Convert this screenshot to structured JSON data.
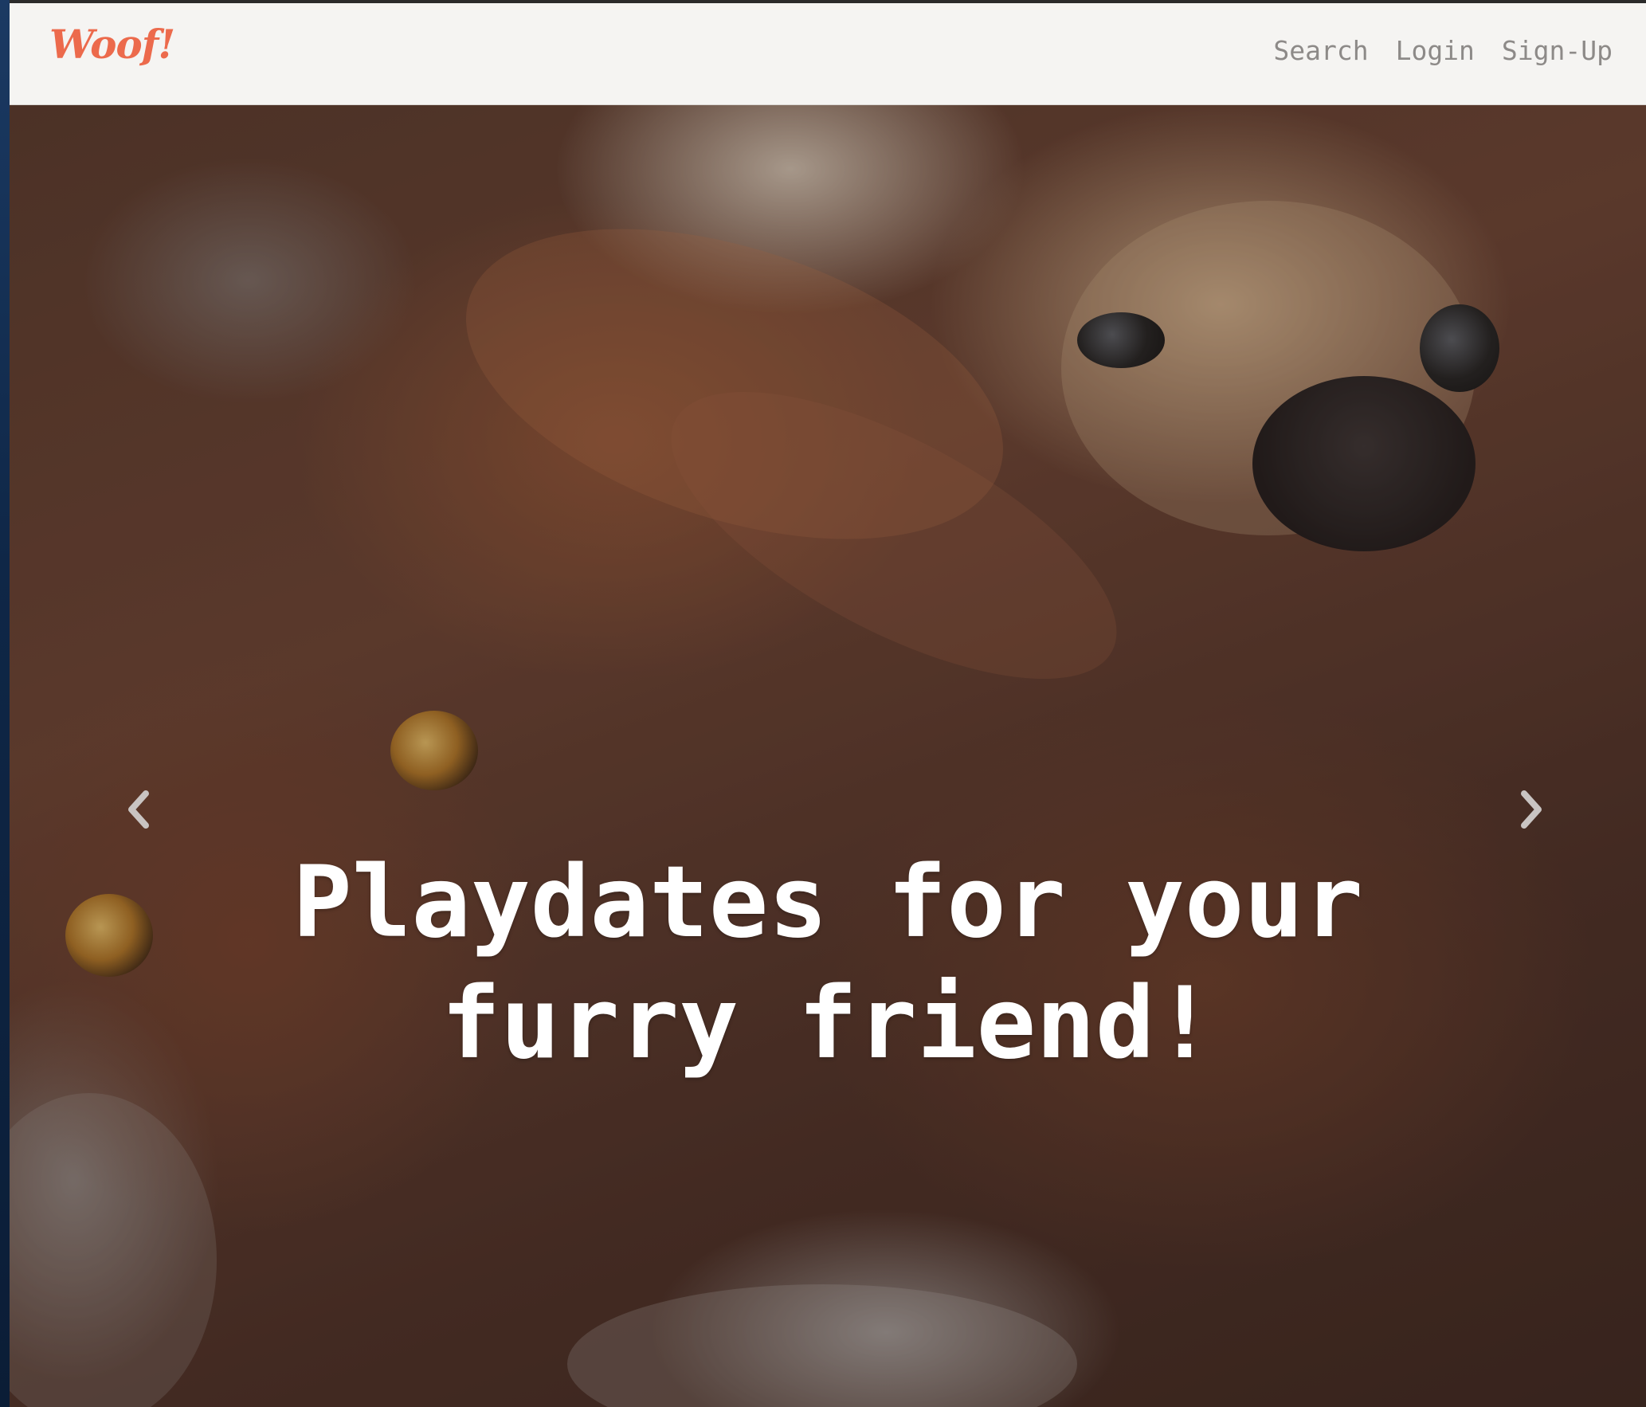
{
  "navbar": {
    "brand": "Woof!",
    "links": [
      {
        "label": "Search"
      },
      {
        "label": "Login"
      },
      {
        "label": "Sign-Up"
      }
    ]
  },
  "hero": {
    "headline_line1": "Playdates for your",
    "headline_line2": "furry friend!",
    "background_image": "photo of two dogs lying together (brown long-haired dog and a pug)",
    "prev_icon": "chevron-left-icon",
    "next_icon": "chevron-right-icon"
  },
  "colors": {
    "brand": "#ec6a4c",
    "navbar_bg": "#f5f4f2",
    "nav_link": "#8d8a88",
    "headline": "#ffffff"
  }
}
